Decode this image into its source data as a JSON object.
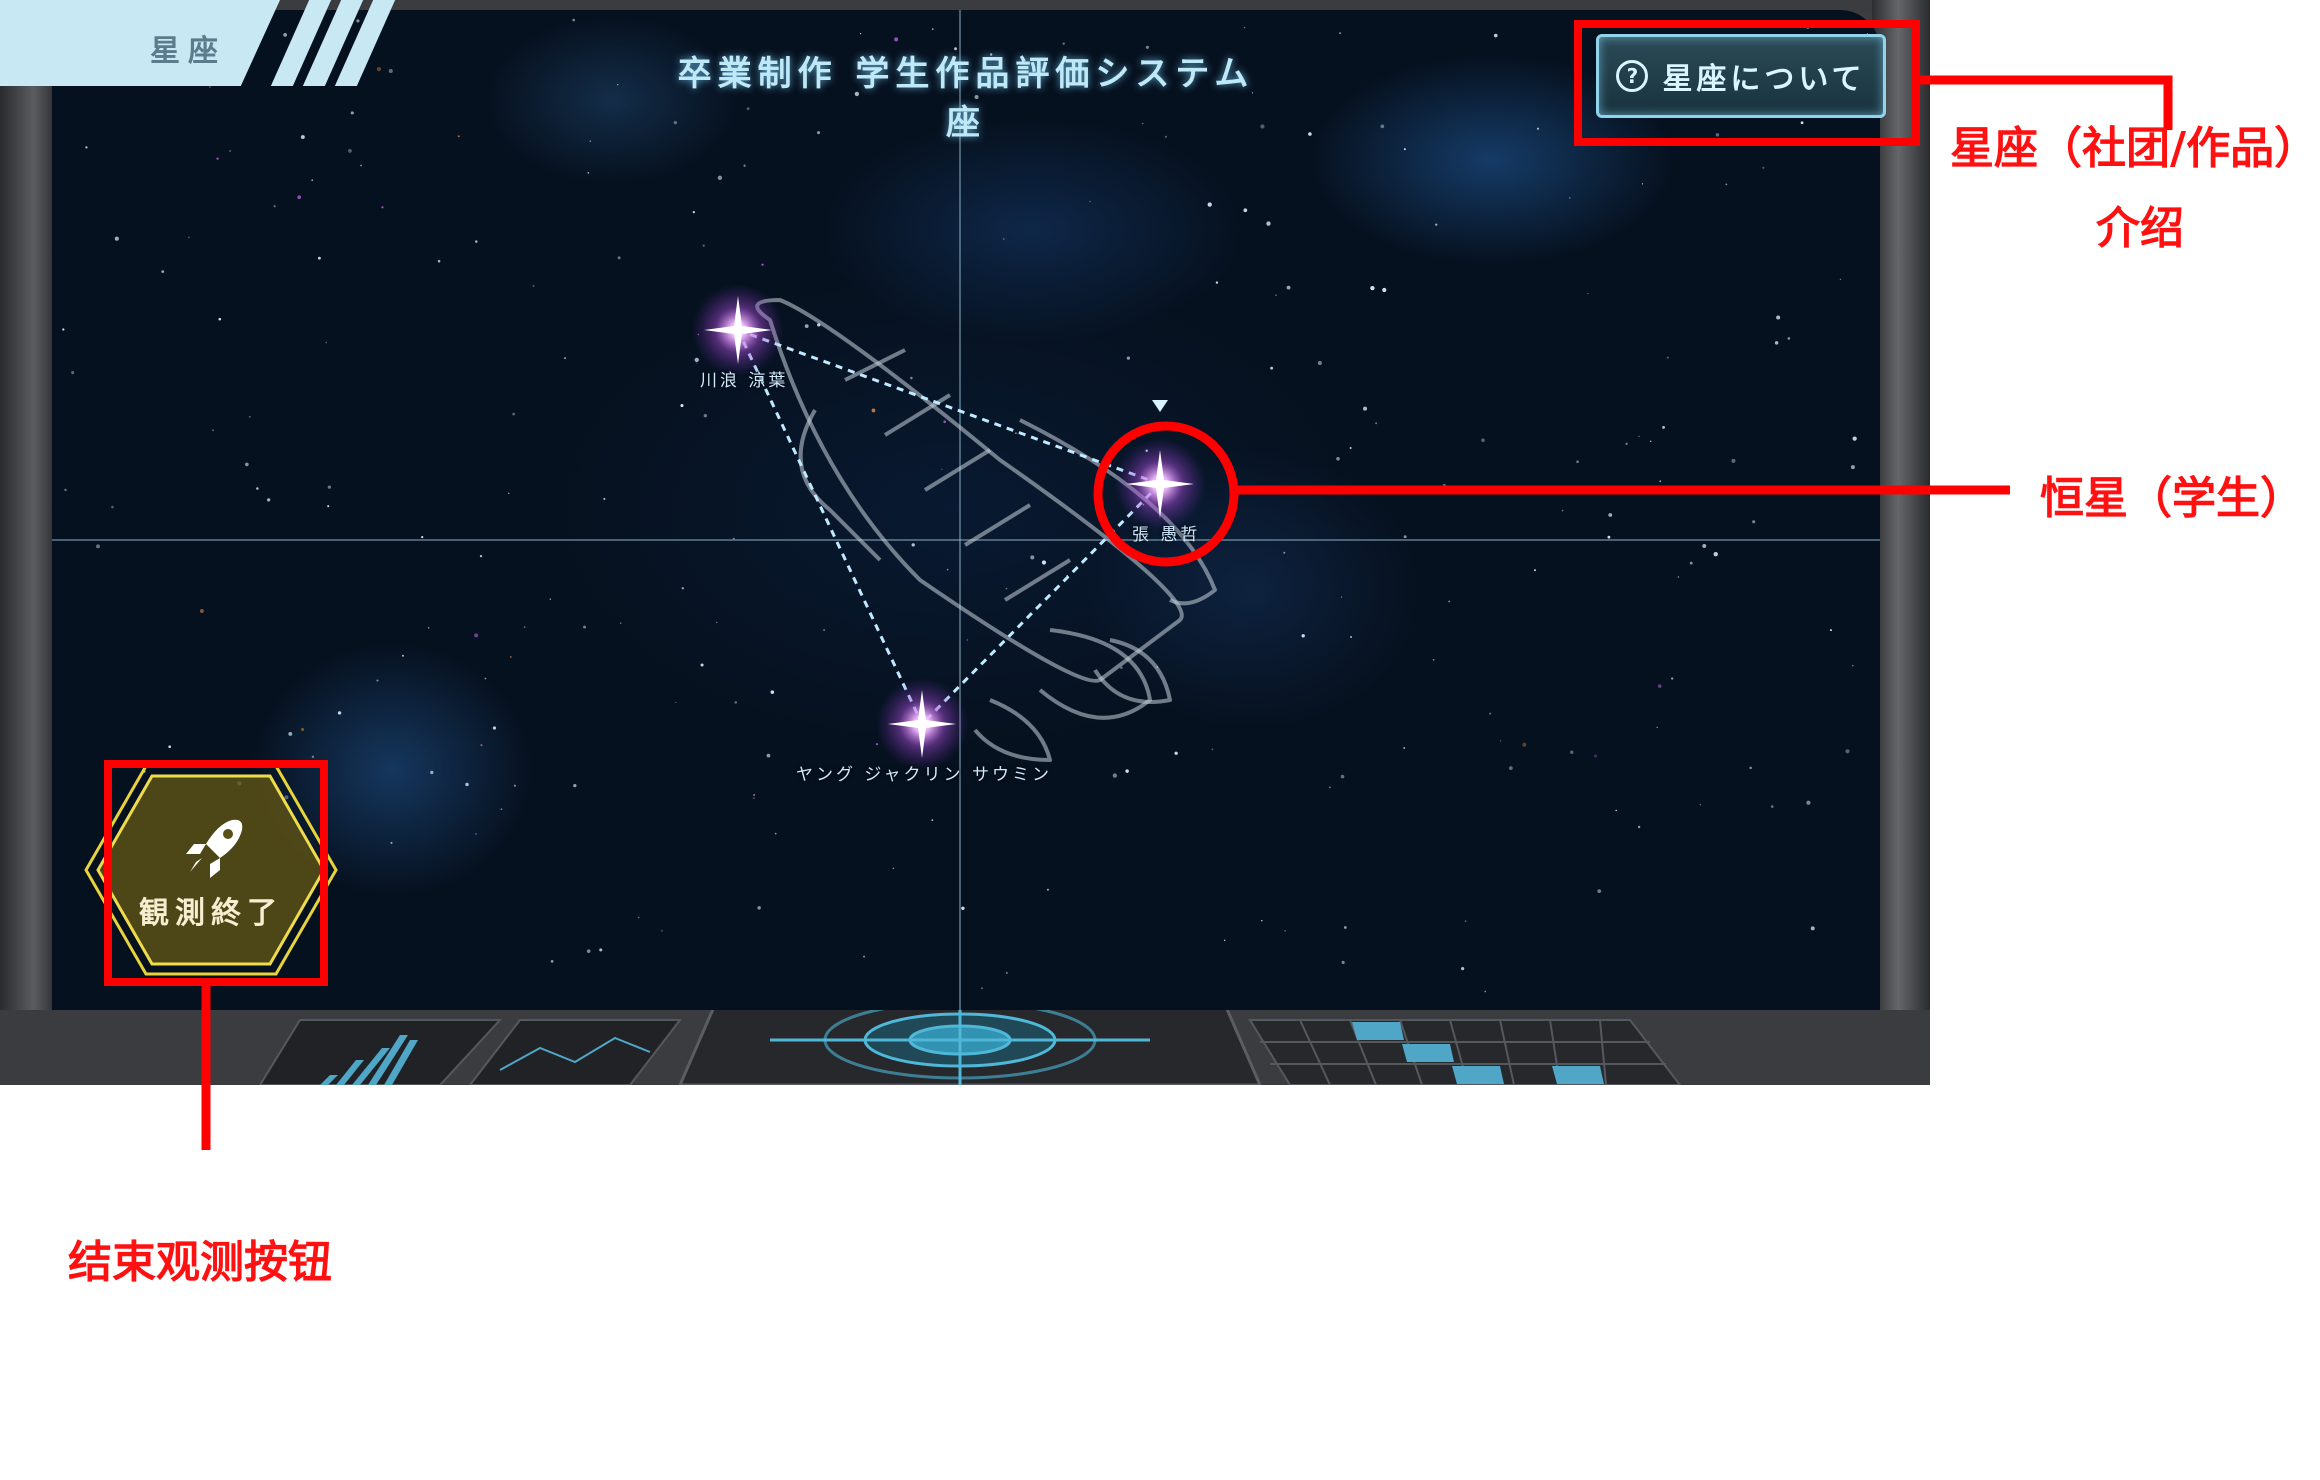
{
  "app": {
    "tab_label": "星座",
    "title": "卒業制作 学生作品評価システム座"
  },
  "about_button": {
    "label": "星座について",
    "icon": "question-icon"
  },
  "stars": [
    {
      "name": "川浪 涼葉"
    },
    {
      "name": "張 愚哲"
    },
    {
      "name": "ヤング ジャクリン サウミン"
    }
  ],
  "end_button": {
    "label": "観測終了",
    "icon": "rocket-icon"
  },
  "annotations": {
    "about_line1": "星座（社团/作品）",
    "about_line2": "介绍",
    "star": "恒星（学生）",
    "end": "结束观测按钮"
  },
  "colors": {
    "annotation": "#ff0000",
    "accent": "#8fd4ea",
    "star": "#e9a8ff",
    "end_button": "#e6d34a"
  }
}
